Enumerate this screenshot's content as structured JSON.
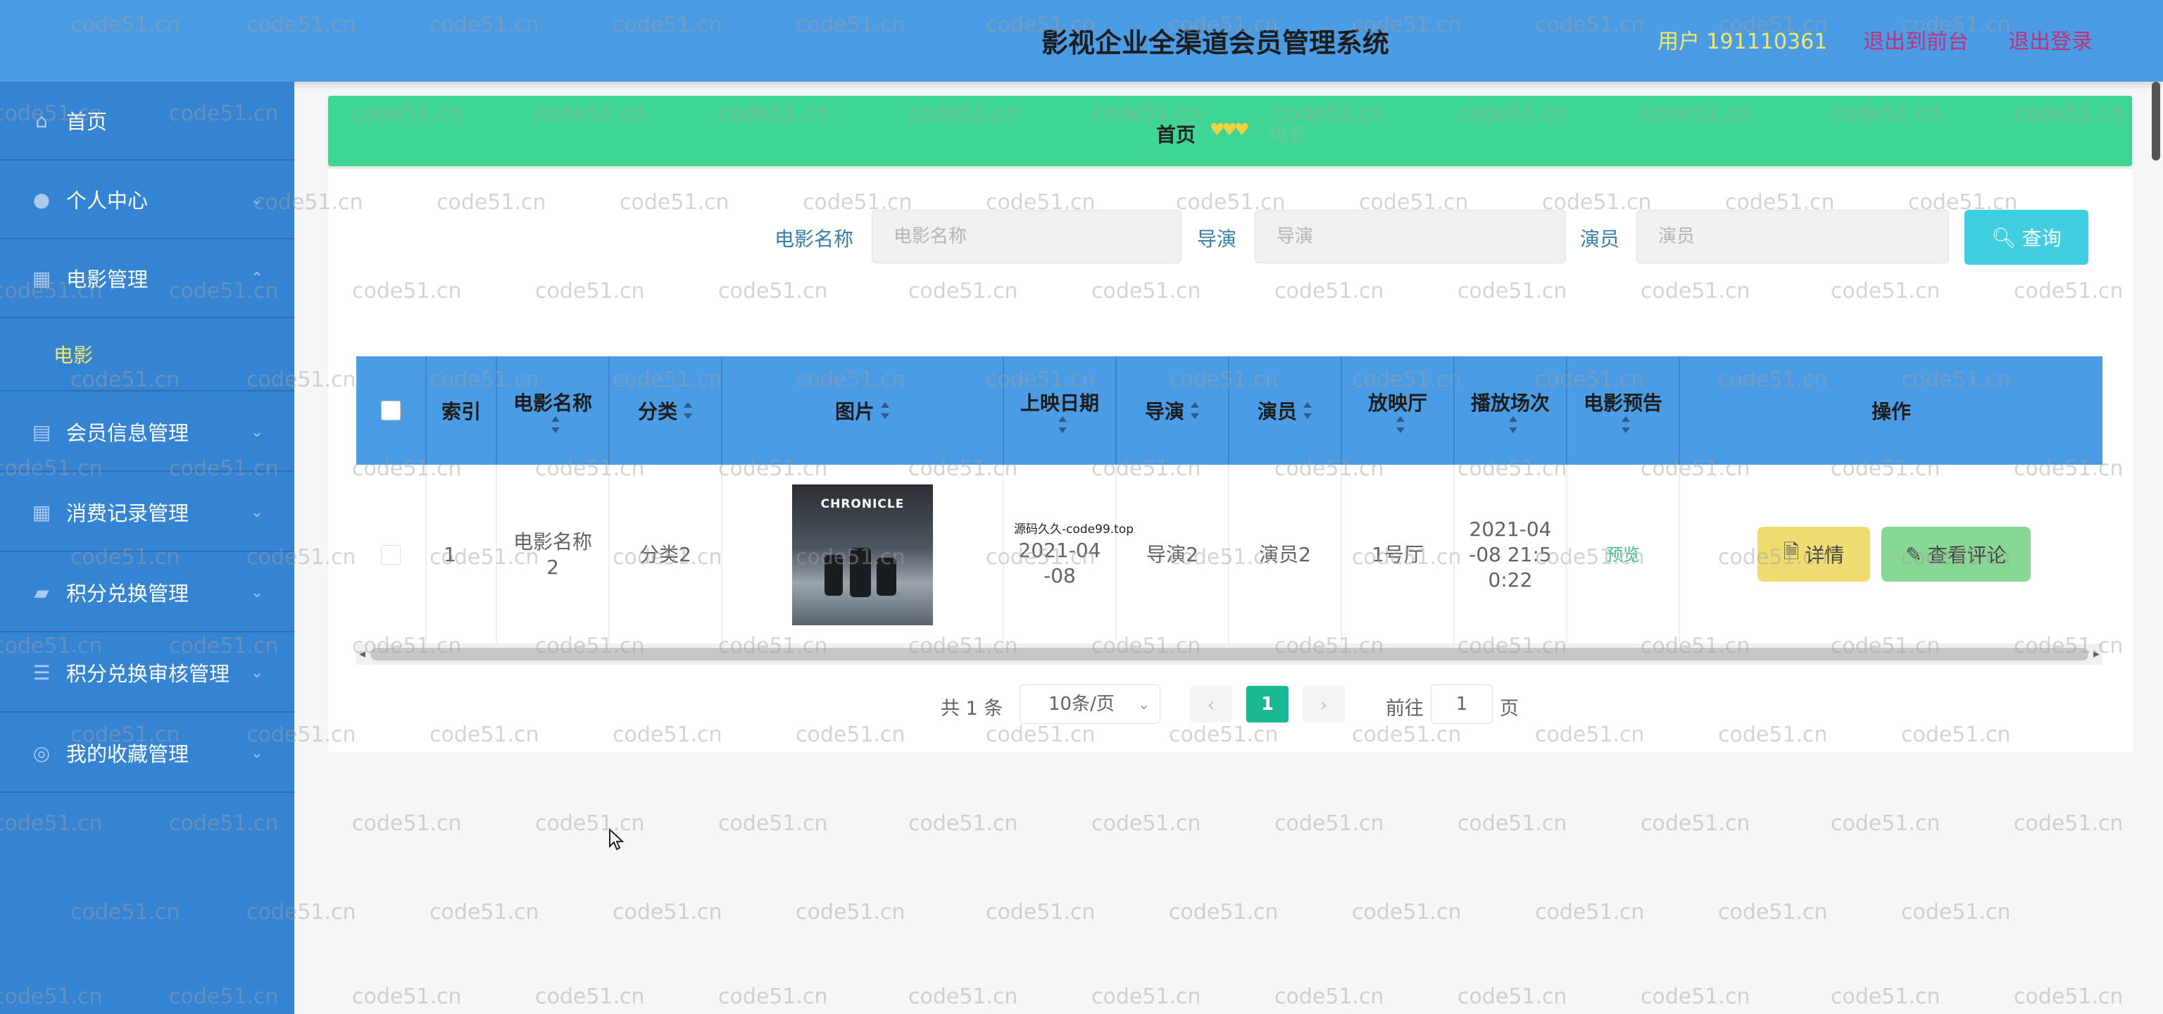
{
  "header": {
    "title": "影视企业全渠道会员管理系统",
    "user": "用户 191110361",
    "back_front": "退出到前台",
    "logout": "退出登录"
  },
  "sidebar": {
    "items": [
      {
        "label": "首页",
        "icon": "home-icon"
      },
      {
        "label": "个人中心",
        "icon": "user-icon"
      },
      {
        "label": "电影管理",
        "icon": "grid-icon"
      },
      {
        "label": "会员信息管理",
        "icon": "clipboard-icon"
      },
      {
        "label": "消费记录管理",
        "icon": "grid-icon"
      },
      {
        "label": "积分兑换管理",
        "icon": "exchange-icon"
      },
      {
        "label": "积分兑换审核管理",
        "icon": "list-icon"
      },
      {
        "label": "我的收藏管理",
        "icon": "star-icon"
      }
    ],
    "sub_active": "电影"
  },
  "breadcrumb": {
    "home": "首页",
    "separator": "♥♥♥",
    "current": "电影"
  },
  "search": {
    "name_label": "电影名称",
    "name_placeholder": "电影名称",
    "director_label": "导演",
    "director_placeholder": "导演",
    "actor_label": "演员",
    "actor_placeholder": "演员",
    "query_button": "查询"
  },
  "table": {
    "headers": [
      "索引",
      "电影名称",
      "分类",
      "图片",
      "上映日期",
      "导演",
      "演员",
      "放映厅",
      "播放场次",
      "电影预告",
      "操作"
    ],
    "row": {
      "index": "1",
      "name": "电影名称2",
      "category": "分类2",
      "poster_title": "CHRONICLE",
      "release_note": "源码久久-code99.top",
      "release_date": "2021-04-08",
      "director": "导演2",
      "actor": "演员2",
      "hall": "1号厅",
      "showtime": "2021-04-08 21:50:22",
      "trailer": "预览",
      "detail_button": "详情",
      "comment_button": "查看评论"
    }
  },
  "pagination": {
    "total": "共 1 条",
    "page_size": "10条/页",
    "current_page": "1",
    "goto_label": "前往",
    "goto_value": "1",
    "page_suffix": "页"
  },
  "watermark": "code51.cn"
}
